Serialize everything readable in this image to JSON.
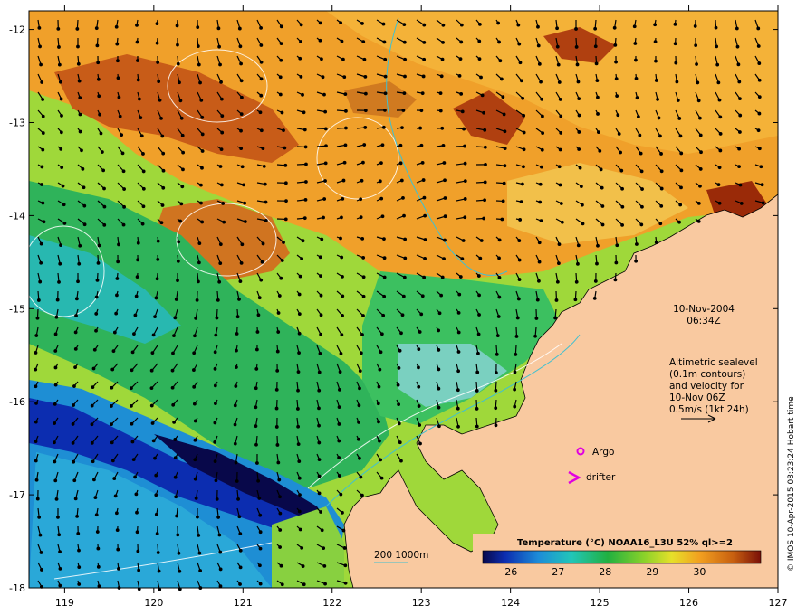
{
  "map": {
    "lon_ticks": [
      "119",
      "120",
      "121",
      "122",
      "123",
      "124",
      "125",
      "126",
      "127"
    ],
    "lat_ticks": [
      "-12",
      "-13",
      "-14",
      "-15",
      "-16",
      "-17",
      "-18"
    ],
    "lon_range": [
      118.6,
      127.0
    ],
    "lat_range": [
      -18.0,
      -11.8
    ]
  },
  "annotations": {
    "date": "10-Nov-2004",
    "time": "06:34Z",
    "altimetry_lines": [
      "Altimetric sealevel",
      "(0.1m contours)",
      "and velocity for",
      "10-Nov 06Z",
      "0.5m/s (1kt 24h)"
    ],
    "argo_label": "Argo",
    "drifter_label": "drifter",
    "depth_legend": "200  1000m"
  },
  "colorbar": {
    "title": "Temperature (°C) NOAA16_L3U 52% ql>=2",
    "labels": [
      "26",
      "27",
      "28",
      "29",
      "30"
    ],
    "range": [
      25.4,
      31.3
    ]
  },
  "credit": "© IMOS 10-Apr-2015 08:23:24 Hobart time",
  "colors": {
    "land": "#f9c9a0",
    "argo": "#e000e0",
    "drifter": "#e000e0",
    "isobath": "#40c0d0"
  }
}
